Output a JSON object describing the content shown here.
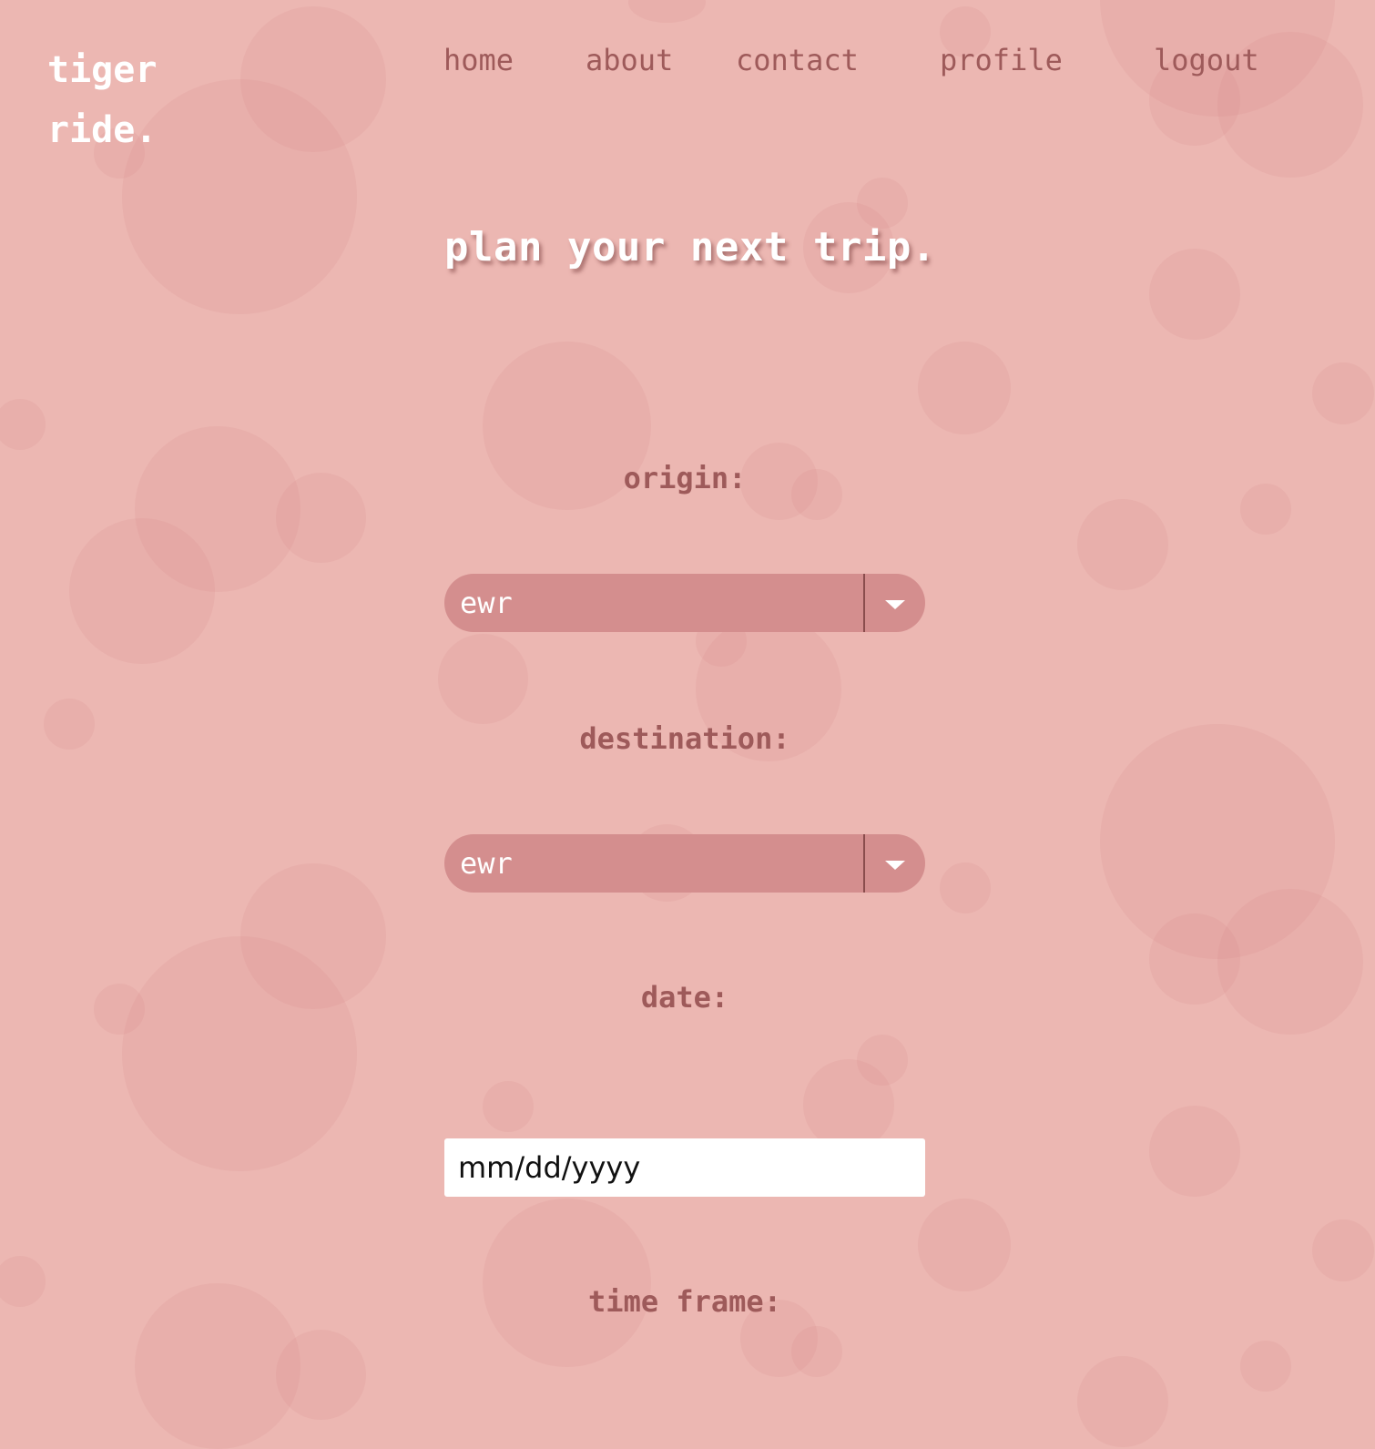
{
  "brand": {
    "line1": "tiger",
    "line2": "ride."
  },
  "nav": {
    "home": "home",
    "about": "about",
    "contact": "contact",
    "profile": "profile",
    "logout": "logout"
  },
  "page": {
    "heading": "plan your next trip."
  },
  "form": {
    "origin": {
      "label": "origin:",
      "value": "ewr"
    },
    "destination": {
      "label": "destination:",
      "value": "ewr"
    },
    "date": {
      "label": "date:",
      "placeholder": "mm/dd/yyyy"
    },
    "time_frame": {
      "label": "time frame:"
    }
  },
  "colors": {
    "background": "#ecb7b2",
    "select_fill": "#d48e8e",
    "label_text": "#9e5a5a",
    "bubble": "#d68c8c"
  },
  "icons": {
    "select_arrow": "chevron-down-icon"
  }
}
